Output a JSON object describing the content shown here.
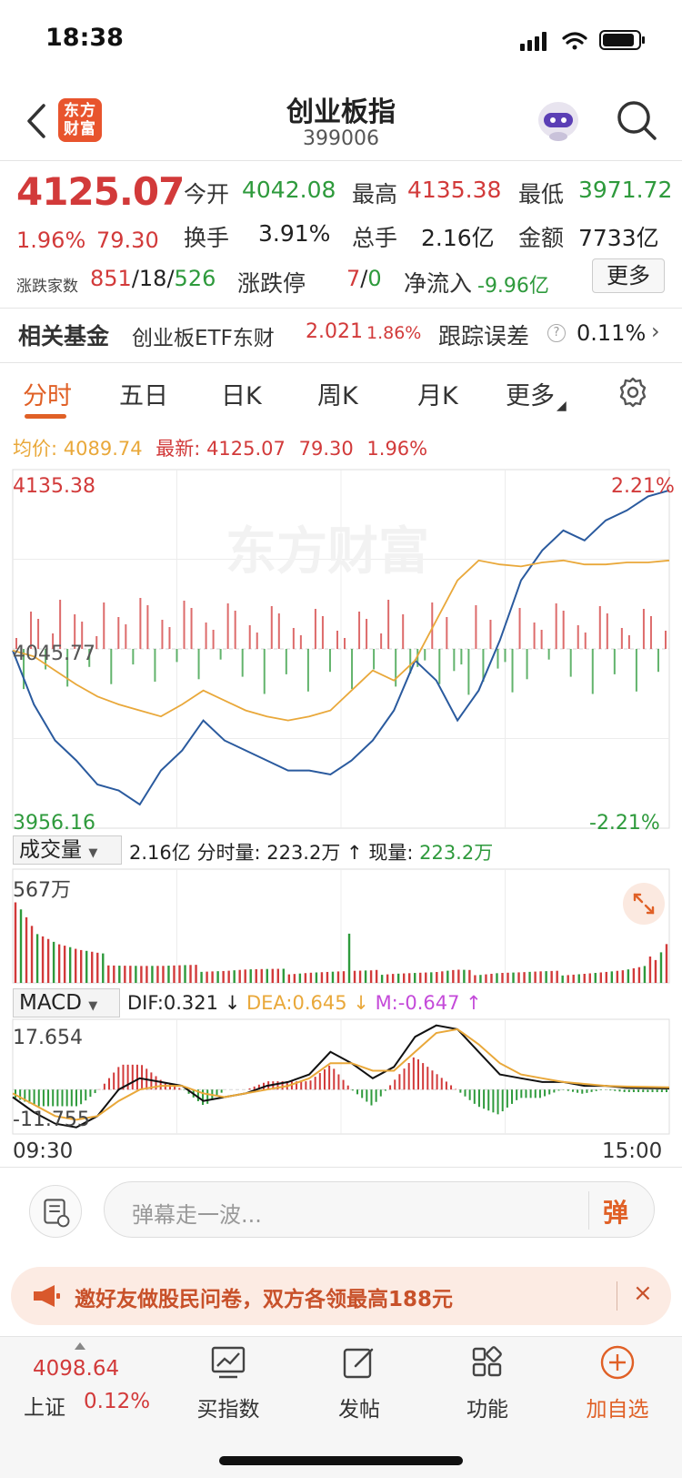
{
  "status_bar": {
    "time": "18:38"
  },
  "header": {
    "logo_text_line1": "东方",
    "logo_text_line2": "财富",
    "title": "创业板指",
    "code": "399006"
  },
  "quote": {
    "price": "4125.07",
    "change_pct": "1.96%",
    "change": "79.30",
    "open_label": "今开",
    "open": "4042.08",
    "high_label": "最高",
    "high": "4135.38",
    "low_label": "最低",
    "low": "3971.72",
    "turnover_label": "换手",
    "turnover": "3.91%",
    "total_vol_label": "总手",
    "total_vol": "2.16亿",
    "amount_label": "金额",
    "amount": "7733亿",
    "updown_label": "涨跌家数",
    "up_count": "851",
    "flat_count": "18",
    "down_count": "526",
    "limit_label": "涨跌停",
    "limit_up": "7",
    "limit_down": "0",
    "inflow_label": "净流入",
    "inflow": "-9.96亿",
    "more_label": "更多"
  },
  "fund": {
    "label": "相关基金",
    "name": "创业板ETF东财",
    "price": "2.021",
    "pct": "1.86%",
    "track_label": "跟踪误差",
    "track_value": "0.11%"
  },
  "tabs": [
    "分时",
    "五日",
    "日K",
    "周K",
    "月K",
    "更多"
  ],
  "chart_info": {
    "avg_label": "均价:",
    "avg_value": "4089.74",
    "latest_label": "最新:",
    "latest_value": "4125.07",
    "latest_change": "79.30",
    "latest_pct": "1.96%",
    "axis_high": "4135.38",
    "axis_mid": "4045.77",
    "axis_low": "3956.16",
    "pct_high": "2.21%",
    "pct_low": "-2.21%",
    "watermark": "东方财富"
  },
  "volume": {
    "select": "成交量",
    "total": "2.16亿",
    "split_label": "分时量:",
    "split_value": "223.2万",
    "now_label": "现量:",
    "now_value": "223.2万",
    "max_label": "567万"
  },
  "macd": {
    "select": "MACD",
    "dif_label": "DIF:0.321",
    "dea_label": "DEA:0.645",
    "m_label": "M:-0.647",
    "axis_high": "17.654",
    "axis_low": "-11.755",
    "time_start": "09:30",
    "time_end": "15:00"
  },
  "comment": {
    "placeholder": "弹幕走一波...",
    "danmu": "弹"
  },
  "banner": {
    "text": "邀好友做股民问卷，双方各领最高188元",
    "close": "×"
  },
  "bottom": {
    "sh_value": "4098.64",
    "sh_label": "上证",
    "sh_pct": "0.12%",
    "buy_label": "买指数",
    "post_label": "发帖",
    "func_label": "功能",
    "fav_label": "加自选"
  },
  "colors": {
    "up": "#d23a3a",
    "down": "#2e9a3c",
    "avg": "#e9a83a",
    "price": "#2a5a9e",
    "accent": "#e06026"
  },
  "chart_data": [
    {
      "type": "line",
      "ylim": [
        3956.16,
        4135.38
      ],
      "x": [
        "09:30",
        "15:00"
      ],
      "series": [
        {
          "values": [
            4045,
            4018,
            4000,
            3990,
            3978,
            3975,
            3968,
            3985,
            3995,
            4010,
            4000,
            3995,
            3990,
            3985,
            3985,
            3983,
            3990,
            4000,
            4015,
            4040,
            4030,
            4010,
            4025,
            4050,
            4080,
            4095,
            4105,
            4100,
            4110,
            4115,
            4122,
            4125
          ]
        },
        {
          "values": [
            4045,
            4042,
            4035,
            4028,
            4022,
            4018,
            4015,
            4012,
            4018,
            4025,
            4020,
            4015,
            4012,
            4010,
            4012,
            4015,
            4025,
            4035,
            4030,
            4040,
            4060,
            4080,
            4090,
            4088,
            4087,
            4089,
            4090,
            4088,
            4088,
            4089,
            4089,
            4090
          ]
        }
      ]
    },
    {
      "type": "bar",
      "ylim": [
        0,
        567
      ],
      "x": [
        "09:30",
        "15:00"
      ],
      "values": [
        567,
        300,
        210,
        160,
        130,
        110,
        95,
        85,
        80,
        75,
        70,
        70,
        65,
        60,
        62,
        60,
        58,
        55,
        58,
        56,
        54,
        60,
        52,
        58,
        55,
        54,
        52,
        55,
        58,
        62,
        75,
        250
      ]
    },
    {
      "type": "line",
      "ylim": [
        -11.755,
        17.654
      ],
      "x": [
        "09:30",
        "15:00"
      ],
      "series": [
        {
          "values": [
            -2,
            -6,
            -9,
            -10,
            -7,
            0,
            3,
            2,
            1,
            -3,
            -2,
            -1,
            1,
            2,
            4,
            10,
            7,
            3,
            6,
            14,
            17,
            16,
            10,
            4,
            3,
            2,
            2,
            1,
            1,
            0.5,
            0.4,
            0.3
          ]
        },
        {
          "values": [
            -1,
            -4,
            -7,
            -8,
            -7,
            -3,
            0,
            1,
            1,
            -1,
            -2,
            -1,
            0,
            1,
            3,
            7,
            7,
            5,
            5,
            10,
            15,
            16,
            12,
            7,
            4,
            3,
            2,
            1.5,
            1,
            0.8,
            0.7,
            0.6
          ]
        }
      ]
    }
  ]
}
